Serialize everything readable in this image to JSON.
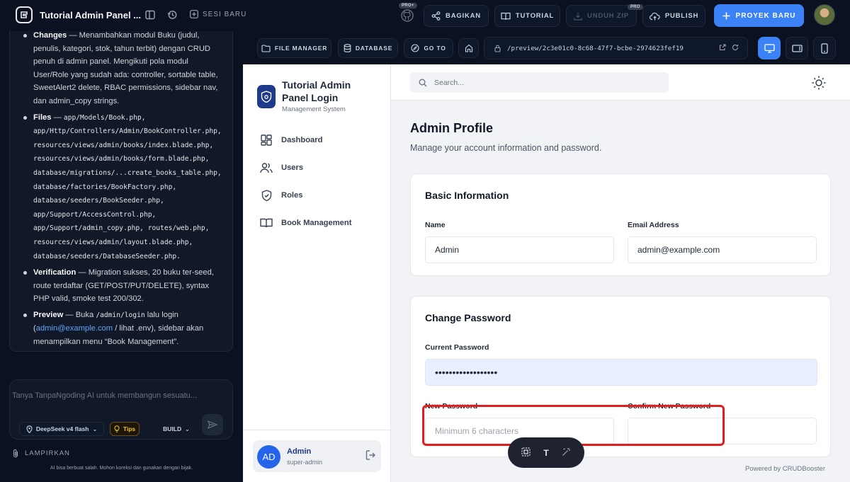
{
  "topbar": {
    "project_title": "Tutorial Admin Panel ...",
    "new_session": "SESI BARU",
    "pro_badge": "PRO+",
    "share": "BAGIKAN",
    "tutorial": "TUTORIAL",
    "download_zip": "UNDUH ZIP",
    "download_badge": "PRO",
    "publish": "PUBLISH",
    "new_project": "PROYEK BARU"
  },
  "chat": {
    "message": {
      "changes_label": "Changes",
      "changes_text": " — Menambahkan modul Buku (judul, penulis, kategori, stok, tahun terbit) dengan CRUD penuh di admin panel. Mengikuti pola modul User/Role yang sudah ada: controller, sortable table, SweetAlert2 delete, RBAC permissions, sidebar nav, dan admin_copy strings.",
      "files_label": "Files",
      "files_sep": " — ",
      "files_text": "app/Models/Book.php, app/Http/Controllers/Admin/BookController.php, resources/views/admin/books/index.blade.php, resources/views/admin/books/form.blade.php, database/migrations/...create_books_table.php, database/factories/BookFactory.php, database/seeders/BookSeeder.php, app/Support/AccessControl.php, app/Support/admin_copy.php, routes/web.php, resources/views/admin/layout.blade.php, database/seeders/DatabaseSeeder.php.",
      "verification_label": "Verification",
      "verification_text": " — Migration sukses, 20 buku ter-seed, route terdaftar (GET/POST/PUT/DELETE), syntax PHP valid, smoke test 200/302.",
      "preview_label": "Preview",
      "preview_text_1": " — Buka ",
      "preview_code": "/admin/login",
      "preview_text_2": " lalu login (",
      "preview_link": "admin@example.com",
      "preview_text_3": " / lihat .env), sidebar akan menampilkan menu “Book Management”."
    },
    "input_placeholder": "Tanya TanpaNgoding AI untuk membangun sesuatu...",
    "model": "DeepSeek v4 flash",
    "tips": "Tips",
    "mode": "BUILD",
    "attach": "LAMPIRKAN",
    "disclaimer": "AI bisa berbuat salah. Mohon koreksi dan gunakan dengan bijak."
  },
  "preview_toolbar": {
    "file_manager": "FILE MANAGER",
    "database": "DATABASE",
    "goto": "GO TO",
    "url": "/preview/2c3e01c0-8c68-47f7-bcbe-2974623fef19"
  },
  "app": {
    "brand_title": "Tutorial Admin Panel Login",
    "brand_subtitle": "Management System",
    "nav": [
      {
        "label": "Dashboard",
        "icon": "dashboard-icon"
      },
      {
        "label": "Users",
        "icon": "users-icon"
      },
      {
        "label": "Roles",
        "icon": "shield-icon"
      },
      {
        "label": "Book Management",
        "icon": "book-icon"
      }
    ],
    "user": {
      "initials": "AD",
      "name": "Admin",
      "role": "super-admin"
    },
    "search_placeholder": "Search...",
    "page_title": "Admin Profile",
    "page_subtitle": "Manage your account information and password.",
    "basic_info": {
      "title": "Basic Information",
      "name_label": "Name",
      "name_value": "Admin",
      "email_label": "Email Address",
      "email_value": "admin@example.com"
    },
    "change_password": {
      "title": "Change Password",
      "current_label": "Current Password",
      "current_value": "••••••••••••••••••",
      "new_label": "New Password",
      "new_placeholder": "Minimum 6 characters",
      "confirm_label": "Confirm New Password"
    },
    "powered_by": "Powered by CRUDBooster"
  },
  "floating_toolbar": {
    "text_tool": "T"
  },
  "colors": {
    "accent": "#3b82f6",
    "highlight": "#e11d1d",
    "dark_bg": "#0b1120"
  }
}
